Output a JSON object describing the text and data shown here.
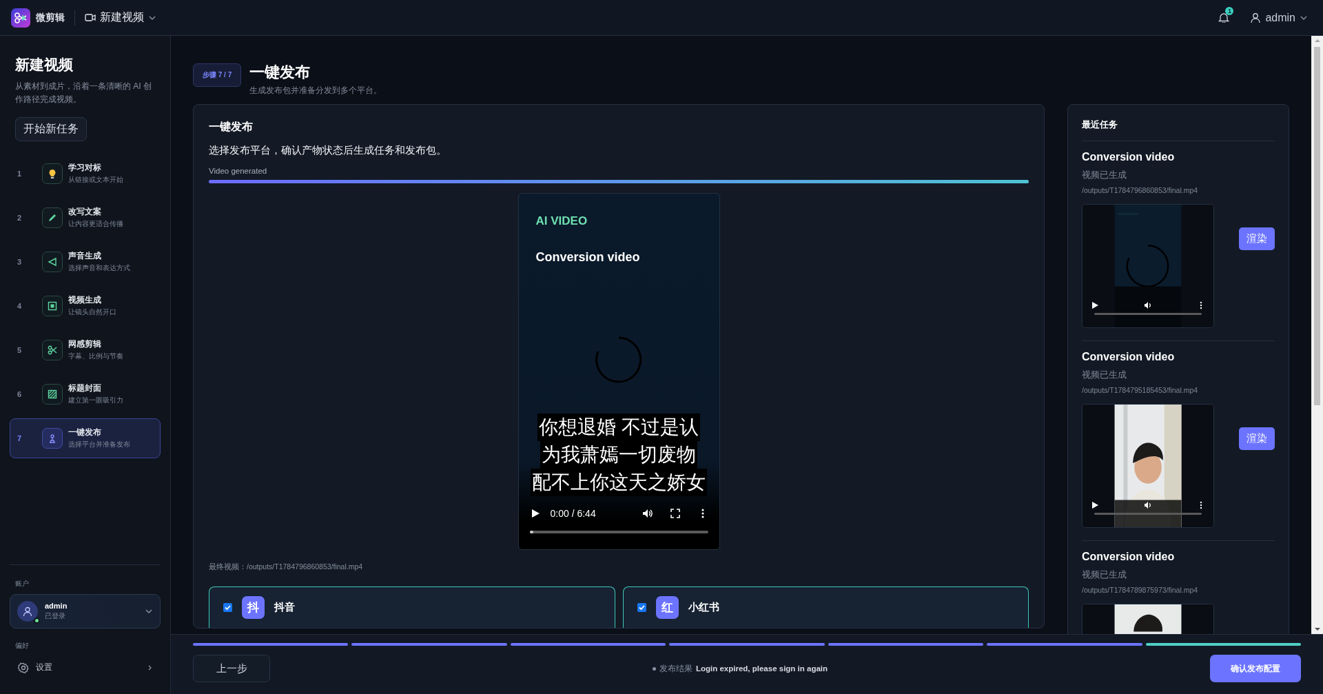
{
  "app": {
    "name": "微剪辑",
    "menu": {
      "label": "新建视频"
    }
  },
  "topbar": {
    "notifications": "1",
    "user": "admin"
  },
  "sidebar": {
    "title": "新建视频",
    "description": "从素材到成片，沿着一条清晰的 AI 创作路径完成视频。",
    "new_task_button": "开始新任务",
    "steps": [
      {
        "number": "1",
        "title": "学习对标",
        "subtitle": "从链接或文本开始",
        "selected": false
      },
      {
        "number": "2",
        "title": "改写文案",
        "subtitle": "让内容更适合传播",
        "selected": false
      },
      {
        "number": "3",
        "title": "声音生成",
        "subtitle": "选择声音和表达方式",
        "selected": false
      },
      {
        "number": "4",
        "title": "视频生成",
        "subtitle": "让镜头自然开口",
        "selected": false
      },
      {
        "number": "5",
        "title": "网感剪辑",
        "subtitle": "字幕、比例与节奏",
        "selected": false
      },
      {
        "number": "6",
        "title": "标题封面",
        "subtitle": "建立第一眼吸引力",
        "selected": false
      },
      {
        "number": "7",
        "title": "一键发布",
        "subtitle": "选择平台并准备发布",
        "selected": true
      }
    ],
    "account_label": "账户",
    "account": {
      "name": "admin",
      "status": "已登录",
      "online": true
    },
    "preferences_label": "偏好",
    "settings": "设置"
  },
  "page": {
    "step_badge": "步骤 7 / 7",
    "title": "一键发布",
    "subtitle": "生成发布包并准备分发到多个平台。"
  },
  "publish_card": {
    "title": "一键发布",
    "description": "选择发布平台，确认产物状态后生成任务和发布包。",
    "progress": {
      "label": "Video generated",
      "level": 1
    },
    "player": {
      "tag": "AI VIDEO",
      "title": "Conversion video",
      "subtitles": [
        "你想退婚 不过是认",
        "为我萧嫣一切废物",
        "配不上你这天之娇女"
      ],
      "time": "0:00 / 6:44",
      "level": 0.02
    },
    "final_video": "最终视频：/outputs/T1784796860853/final.mp4",
    "platforms": [
      {
        "badge": "抖",
        "name": "抖音",
        "checked": true
      },
      {
        "badge": "红",
        "name": "小红书",
        "checked": true
      }
    ]
  },
  "recent": {
    "title": "最近任务",
    "tasks": [
      {
        "title": "Conversion video",
        "status": "视频已生成",
        "path": "/outputs/T1784796860853/final.mp4",
        "thumbnail": {
          "kind": "picture",
          "controls": true
        },
        "render_button": "渲染"
      },
      {
        "title": "Conversion video",
        "status": "视频已生成",
        "path": "/outputs/T1784795185453/final.mp4",
        "thumbnail": {
          "kind": "picture",
          "controls": true
        },
        "render_button": "渲染"
      },
      {
        "title": "Conversion video",
        "status": "视频已生成",
        "path": "/outputs/T1784789875973/final.mp4",
        "thumbnail": {
          "kind": "picture"
        }
      }
    ]
  },
  "footer": {
    "segments": [
      {
        "selected": false
      },
      {
        "selected": false
      },
      {
        "selected": false
      },
      {
        "selected": false
      },
      {
        "selected": false
      },
      {
        "selected": false
      },
      {
        "selected": true
      }
    ],
    "back_button": "上一步",
    "status_label": "发布结果",
    "status_message": "Login expired, please sign in again",
    "confirm_button": "确认发布配置"
  }
}
